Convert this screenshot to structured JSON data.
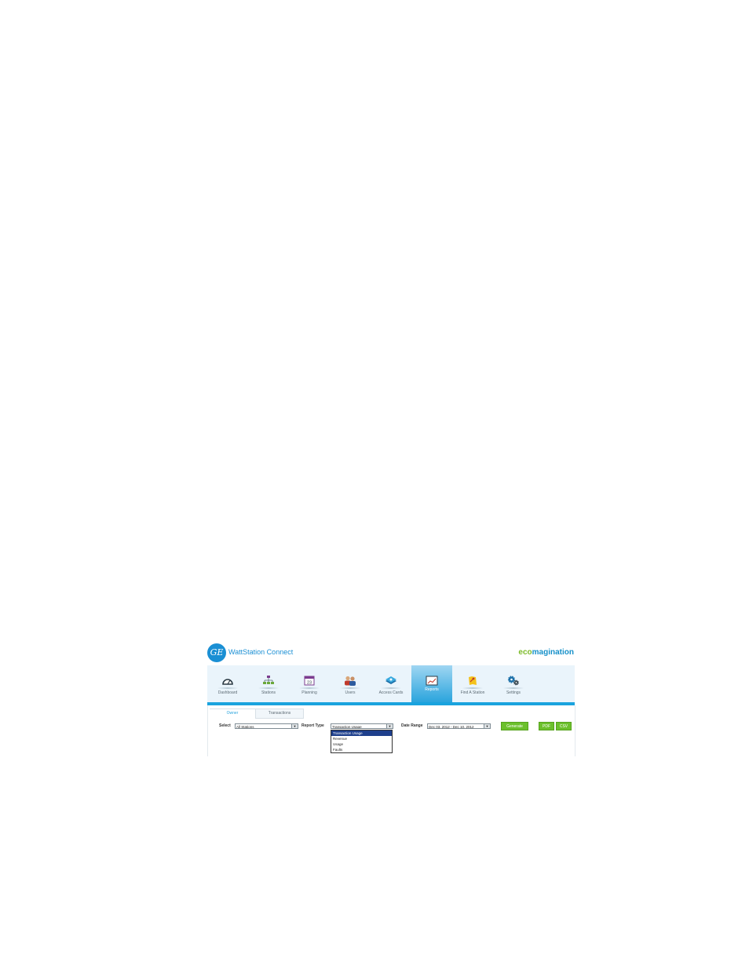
{
  "header": {
    "logo_text": "GE",
    "app_title": "WattStation Connect",
    "brand_eco": "eco",
    "brand_rest": "magination"
  },
  "nav": {
    "items": [
      {
        "label": "Dashboard",
        "icon": "gauge-icon"
      },
      {
        "label": "Stations",
        "icon": "network-icon"
      },
      {
        "label": "Planning",
        "icon": "calendar-icon"
      },
      {
        "label": "Users",
        "icon": "users-icon"
      },
      {
        "label": "Access Cards",
        "icon": "cards-icon"
      },
      {
        "label": "Reports",
        "icon": "report-icon"
      },
      {
        "label": "Find A Station",
        "icon": "map-icon"
      },
      {
        "label": "Settings",
        "icon": "gear-icon"
      }
    ],
    "active": "Reports",
    "calendar_day": "23"
  },
  "tabs": {
    "owner": "Owner",
    "transactions": "Transactions"
  },
  "filters": {
    "select_label": "Select",
    "select_value": "All Stations",
    "report_type_label": "Report Type",
    "report_type_value": "Transaction Usage",
    "report_type_options": [
      "Transaction Usage",
      "Revenue",
      "Usage",
      "Faults"
    ],
    "date_range_label": "Date Range",
    "date_range_value": "Dec 03, 2012 - Dec 10, 2012"
  },
  "buttons": {
    "generate": "Generate",
    "pdf": "PDF",
    "csv": "CSV"
  },
  "colors": {
    "accent": "#1aa3de",
    "brand_green": "#7dbb29",
    "button_green": "#6cc02c",
    "selected_option": "#1e3f8c"
  }
}
